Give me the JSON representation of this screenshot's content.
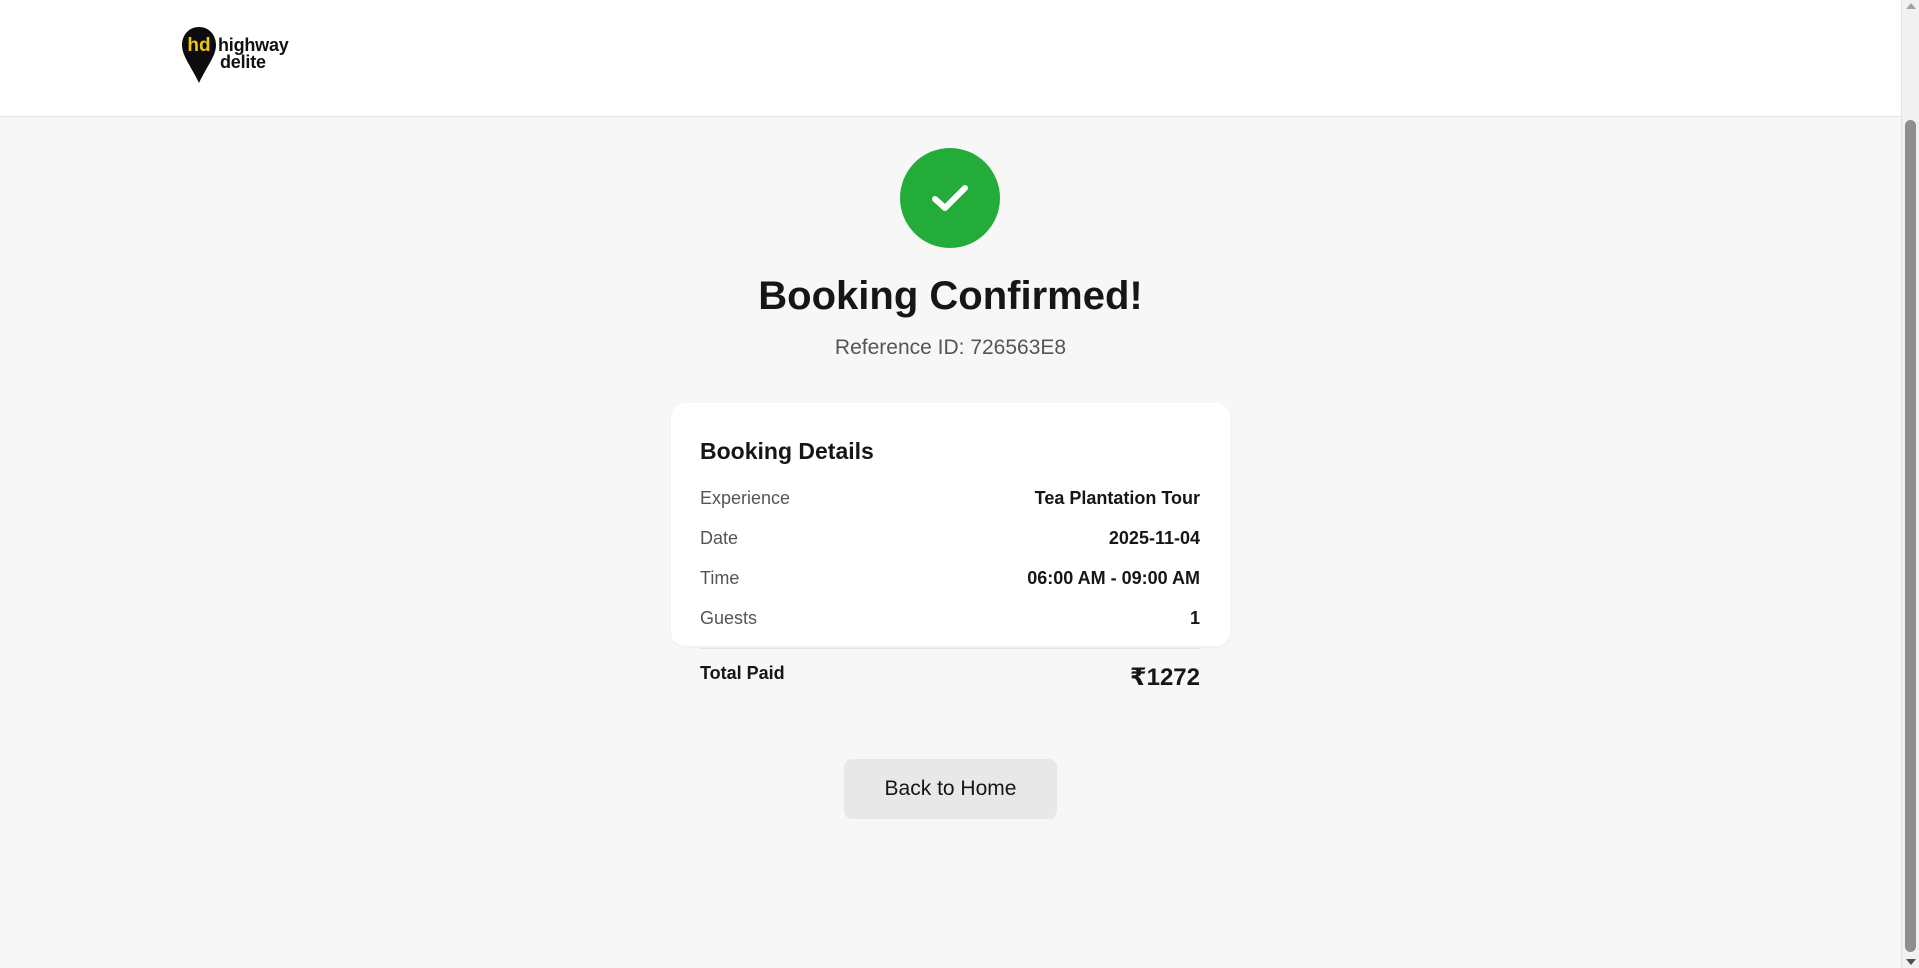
{
  "header": {
    "logo_line1": "highway",
    "logo_line2": "delite",
    "logo_monogram": "hd"
  },
  "confirmation": {
    "title": "Booking Confirmed!",
    "reference": "Reference ID: 726563E8",
    "status_color": "#24ac3b"
  },
  "details": {
    "title": "Booking Details",
    "rows": [
      {
        "label": "Experience",
        "value": "Tea Plantation Tour"
      },
      {
        "label": "Date",
        "value": "2025-11-04"
      },
      {
        "label": "Time",
        "value": "06:00 AM - 09:00 AM"
      },
      {
        "label": "Guests",
        "value": "1"
      }
    ],
    "total_label": "Total Paid",
    "total_value": "₹1272"
  },
  "actions": {
    "back_home_label": "Back to Home"
  },
  "icons": {
    "success": "checkmark-icon",
    "logo": "location-pin-icon",
    "scroll_up": "scroll-up-arrow-icon",
    "scroll_down": "scroll-down-arrow-icon"
  }
}
